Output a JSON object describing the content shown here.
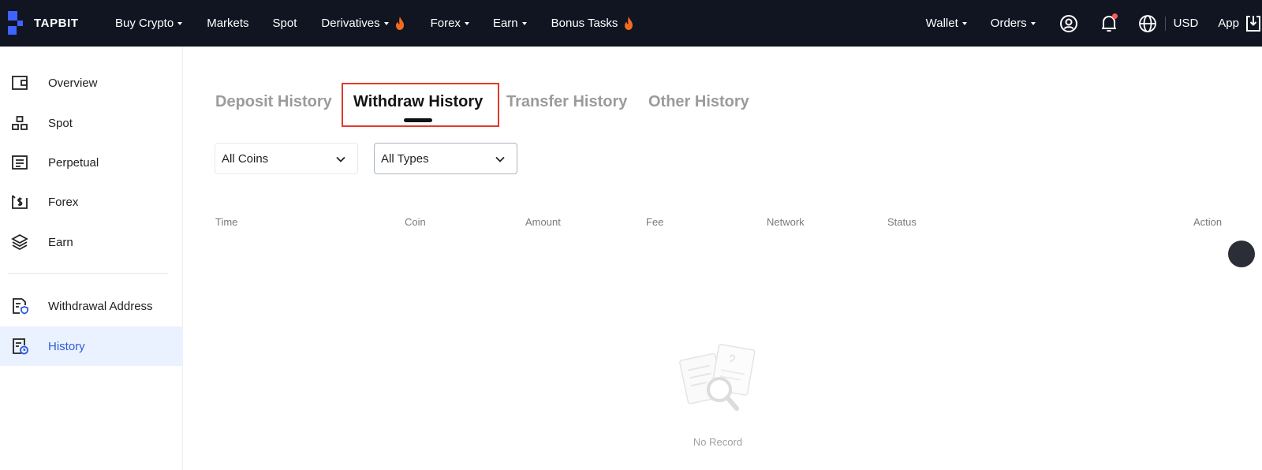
{
  "brand": {
    "name": "TAPBIT",
    "logo_color": "#3f63ff"
  },
  "topnav": {
    "items": [
      {
        "label": "Buy Crypto",
        "dropdown": true,
        "hot": false
      },
      {
        "label": "Markets",
        "dropdown": false,
        "hot": false
      },
      {
        "label": "Spot",
        "dropdown": false,
        "hot": false
      },
      {
        "label": "Derivatives",
        "dropdown": true,
        "hot": true
      },
      {
        "label": "Forex",
        "dropdown": true,
        "hot": false
      },
      {
        "label": "Earn",
        "dropdown": true,
        "hot": false
      },
      {
        "label": "Bonus Tasks",
        "dropdown": false,
        "hot": true
      }
    ],
    "right": {
      "wallet": "Wallet",
      "orders": "Orders",
      "currency": "USD",
      "app": "App"
    }
  },
  "sidebar": {
    "items": [
      {
        "label": "Overview",
        "icon": "wallet-icon"
      },
      {
        "label": "Spot",
        "icon": "spot-icon"
      },
      {
        "label": "Perpetual",
        "icon": "perpetual-icon"
      },
      {
        "label": "Forex",
        "icon": "forex-icon"
      },
      {
        "label": "Earn",
        "icon": "layers-icon"
      },
      {
        "label": "Withdrawal Address",
        "icon": "address-book-icon"
      },
      {
        "label": "History",
        "icon": "history-icon"
      }
    ],
    "active_index": 6
  },
  "main": {
    "tabs": [
      {
        "label": "Deposit History"
      },
      {
        "label": "Withdraw History"
      },
      {
        "label": "Transfer History"
      },
      {
        "label": "Other History"
      }
    ],
    "active_tab": 1,
    "filters": {
      "coin": "All Coins",
      "type": "All Types"
    },
    "table": {
      "columns": [
        "Time",
        "Coin",
        "Amount",
        "Fee",
        "Network",
        "Status",
        "Action"
      ],
      "rows": []
    },
    "empty_state": "No Record"
  },
  "colors": {
    "topbar_bg": "#111522",
    "accent_blue": "#2f5bd8",
    "highlight_red": "#e03a2a",
    "hot_orange": "#f26b1d"
  }
}
